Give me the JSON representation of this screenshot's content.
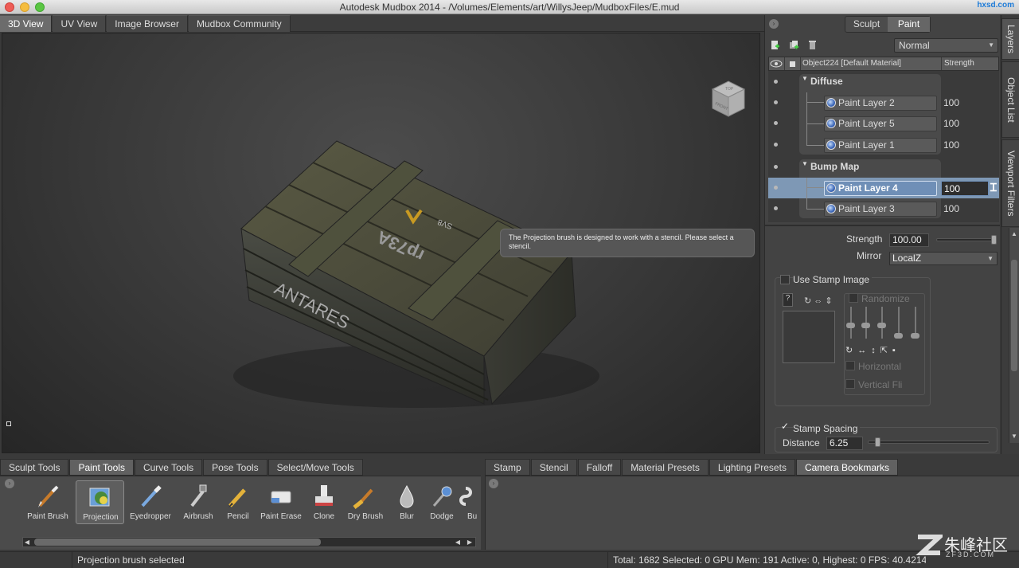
{
  "window": {
    "title": "Autodesk Mudbox 2014 - /Volumes/Elements/art/WillysJeep/MudboxFiles/E.mud",
    "watermark_top": "hxsd.com"
  },
  "view_tabs": [
    "3D View",
    "UV View",
    "Image Browser",
    "Mudbox Community"
  ],
  "viewport": {
    "nav_cube": {
      "top": "TOP",
      "front": "FRONT"
    },
    "crate_text": {
      "front": "ANTARES",
      "top": "rp73A",
      "stamp": "SV8"
    },
    "tooltip": "The Projection brush is designed to work with a stencil. Please select a stencil."
  },
  "panel": {
    "mode_toggle": [
      "Sculpt",
      "Paint"
    ],
    "active_mode": "Paint",
    "blend_mode": "Normal",
    "side_tabs": [
      "Layers",
      "Object List",
      "Viewport Filters"
    ],
    "layer_header": {
      "object": "Object224 [Default Material]",
      "strength": "Strength"
    },
    "groups": [
      {
        "name": "Diffuse",
        "layers": [
          {
            "name": "Paint Layer 2",
            "strength": "100"
          },
          {
            "name": "Paint Layer 5",
            "strength": "100"
          },
          {
            "name": "Paint Layer 1",
            "strength": "100"
          }
        ]
      },
      {
        "name": "Bump Map",
        "layers": [
          {
            "name": "Paint Layer 4",
            "strength": "100"
          },
          {
            "name": "Paint Layer 3",
            "strength": "100"
          }
        ]
      }
    ],
    "selected_layer": "Paint Layer 4",
    "props": {
      "strength_label": "Strength",
      "strength_value": "100.00",
      "strength_level": 1.0,
      "mirror_label": "Mirror",
      "mirror_value": "LocalZ",
      "use_stamp_label": "Use Stamp Image",
      "use_stamp_checked": false,
      "randomize_label": "Randomize",
      "horizontal_label": "Horizontal",
      "vertical_label": "Vertical Fli",
      "stamp_spacing_label": "Stamp Spacing",
      "stamp_spacing_checked": true,
      "distance_label": "Distance",
      "distance_value": "6.25",
      "distance_level": 0.06
    }
  },
  "tool_tabs": [
    "Sculpt Tools",
    "Paint Tools",
    "Curve Tools",
    "Pose Tools",
    "Select/Move Tools"
  ],
  "active_tool_tab": "Paint Tools",
  "tools": [
    {
      "label": "Paint Brush",
      "icon": "paint-brush-icon"
    },
    {
      "label": "Projection",
      "icon": "projection-icon"
    },
    {
      "label": "Eyedropper",
      "icon": "eyedropper-icon"
    },
    {
      "label": "Airbrush",
      "icon": "airbrush-icon"
    },
    {
      "label": "Pencil",
      "icon": "pencil-icon"
    },
    {
      "label": "Paint Erase",
      "icon": "eraser-icon"
    },
    {
      "label": "Clone",
      "icon": "clone-stamp-icon"
    },
    {
      "label": "Dry Brush",
      "icon": "dry-brush-icon"
    },
    {
      "label": "Blur",
      "icon": "blur-drop-icon"
    },
    {
      "label": "Dodge",
      "icon": "dodge-icon"
    },
    {
      "label": "Bu",
      "icon": "burn-icon"
    }
  ],
  "active_tool": "Projection",
  "library_tabs": [
    "Stamp",
    "Stencil",
    "Falloff",
    "Material Presets",
    "Lighting Presets",
    "Camera Bookmarks"
  ],
  "active_library_tab": "Camera Bookmarks",
  "status": {
    "message": "Projection brush selected",
    "stats": "Total: 1682  Selected: 0 GPU Mem: 191  Active: 0, Highest: 0  FPS: 40.4214"
  },
  "watermark_bottom": {
    "brand": "朱峰社区",
    "site": "ZF3D.COM"
  },
  "colors": {
    "selection": "#7e98b5",
    "panel_bg": "#434343",
    "viewport_bg": "#3c3c3c"
  }
}
